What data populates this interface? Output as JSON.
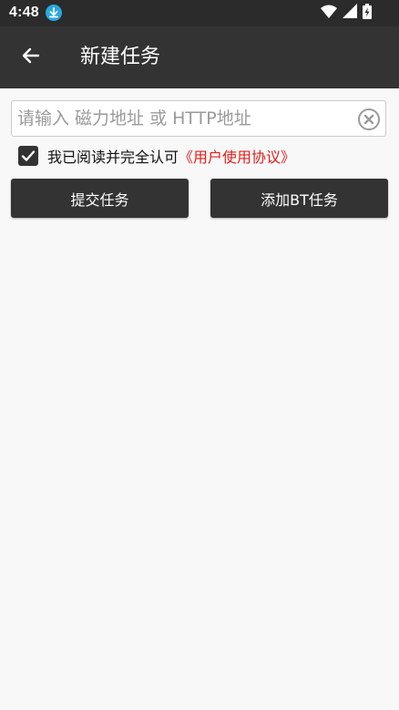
{
  "status_bar": {
    "time": "4:48",
    "icons": [
      "download-notification-icon",
      "wifi-icon",
      "signal-icon",
      "battery-charging-icon"
    ],
    "accent_color": "#29a8e0"
  },
  "app_bar": {
    "title": "新建任务",
    "back_icon": "arrow-left-icon",
    "background": "#333333"
  },
  "task_input": {
    "value": "",
    "placeholder": "请输入 磁力地址 或 HTTP地址",
    "clear_icon": "clear-circle-icon"
  },
  "agreement": {
    "checked": true,
    "text": "我已阅读并完全认可",
    "link_text": "《用户使用协议》",
    "link_color": "#e0201c"
  },
  "buttons": {
    "submit_label": "提交任务",
    "add_bt_label": "添加BT任务"
  }
}
